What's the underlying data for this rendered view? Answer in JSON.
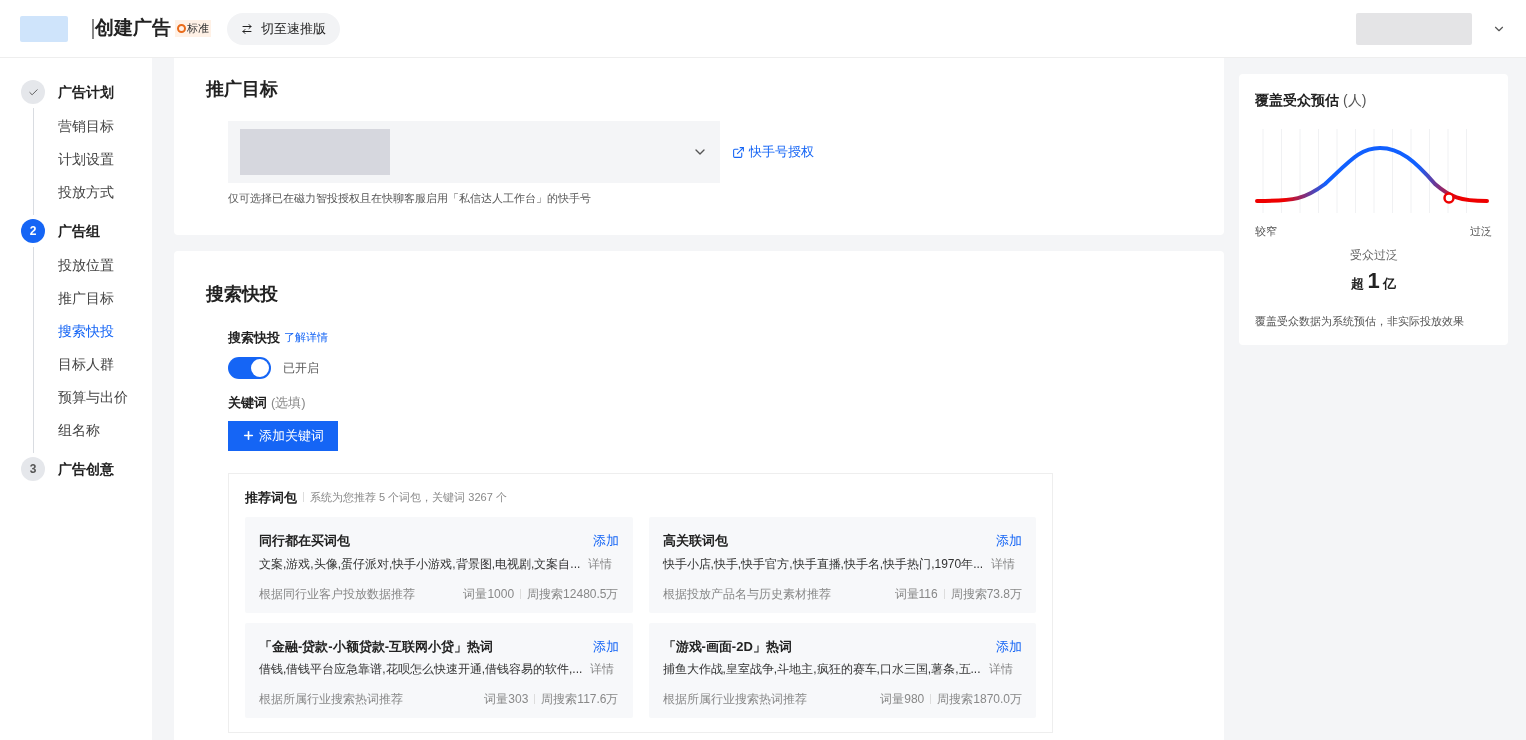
{
  "header": {
    "title": "创建广告",
    "badge": "标准",
    "switch_button": "切至速推版"
  },
  "steps": [
    {
      "title": "广告计划",
      "completed": true,
      "current": false,
      "items": [
        {
          "label": "营销目标",
          "selected": false
        },
        {
          "label": "计划设置",
          "selected": false
        },
        {
          "label": "投放方式",
          "selected": false
        }
      ]
    },
    {
      "number": "2",
      "title": "广告组",
      "completed": false,
      "current": true,
      "items": [
        {
          "label": "投放位置",
          "selected": false
        },
        {
          "label": "推广目标",
          "selected": false
        },
        {
          "label": "搜索快投",
          "selected": true
        },
        {
          "label": "目标人群",
          "selected": false
        },
        {
          "label": "预算与出价",
          "selected": false
        },
        {
          "label": "组名称",
          "selected": false
        }
      ]
    },
    {
      "number": "3",
      "title": "广告创意",
      "completed": false,
      "current": false
    }
  ],
  "promotion_target": {
    "title": "推广目标",
    "auth_link": "快手号授权",
    "hint": "仅可选择已在磁力智投授权且在快聊客服启用「私信达人工作台」的快手号"
  },
  "search_boost": {
    "title": "搜索快投",
    "field_label": "搜索快投",
    "learn_more": "了解详情",
    "toggle": {
      "on": true,
      "label": "已开启"
    },
    "keywords_label": "关键词",
    "keywords_optional": "(选填)",
    "add_button": "添加关键词",
    "packs": {
      "title": "推荐词包",
      "summary": "系统为您推荐 5 个词包，关键词 3267 个",
      "items": [
        {
          "name": "同行都在买词包",
          "add": "添加",
          "keywords": "文案,游戏,头像,蛋仔派对,快手小游戏,背景图,电视剧,文案自...",
          "detail": "详情",
          "source": "根据同行业客户投放数据推荐",
          "count": "词量1000",
          "weekly": "周搜索12480.5万"
        },
        {
          "name": "高关联词包",
          "add": "添加",
          "keywords": "快手小店,快手,快手官方,快手直播,快手名,快手热门,1970年...",
          "detail": "详情",
          "source": "根据投放产品名与历史素材推荐",
          "count": "词量116",
          "weekly": "周搜索73.8万"
        },
        {
          "name": "「金融-贷款-小额贷款-互联网小贷」热词",
          "add": "添加",
          "keywords": "借钱,借钱平台应急靠谱,花呗怎么快速开通,借钱容易的软件,...",
          "detail": "详情",
          "source": "根据所属行业搜索热词推荐",
          "count": "词量303",
          "weekly": "周搜索117.6万"
        },
        {
          "name": "「游戏-画面-2D」热词",
          "add": "添加",
          "keywords": "捕鱼大作战,皇室战争,斗地主,疯狂的赛车,口水三国,薯条,五...",
          "detail": "详情",
          "source": "根据所属行业搜索热词推荐",
          "count": "词量980",
          "weekly": "周搜索1870.0万"
        }
      ]
    }
  },
  "audience": {
    "title": "覆盖受众预估",
    "unit": "(人)",
    "left_label": "较窄",
    "right_label": "过泛",
    "verdict": "受众过泛",
    "prefix": "超",
    "number": "1",
    "suffix": "亿",
    "note": "覆盖受众数据为系统预估，非实际投放效果"
  }
}
